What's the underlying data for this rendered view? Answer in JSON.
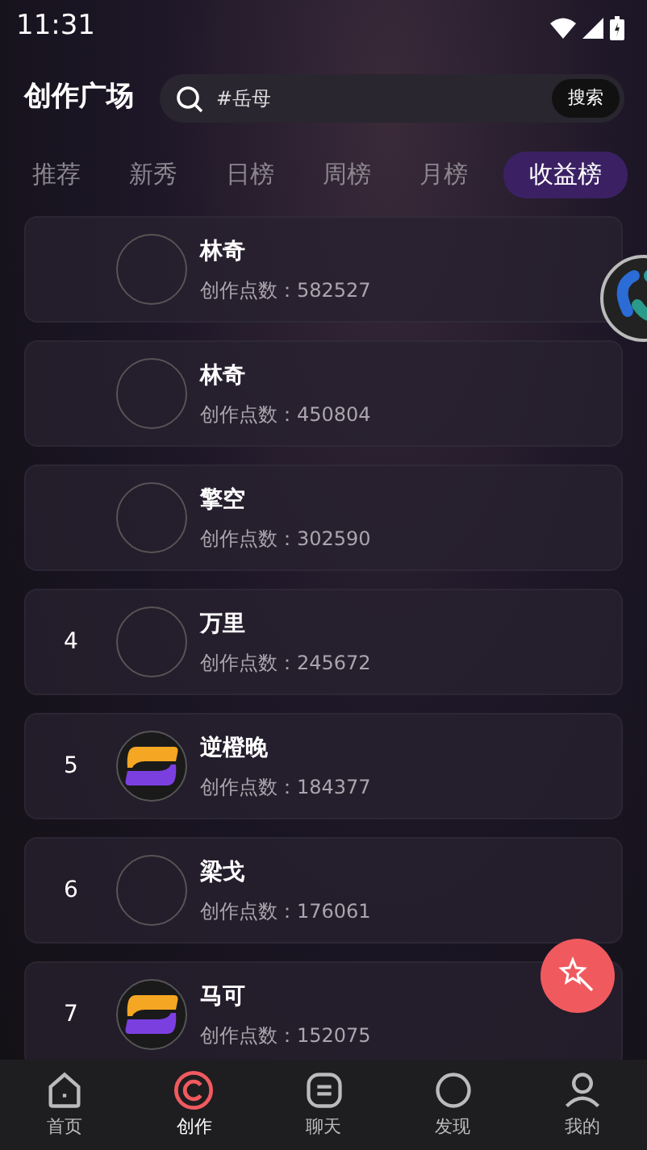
{
  "status_bar": {
    "time": "11:31"
  },
  "header": {
    "title": "创作广场",
    "search": {
      "value": "#岳母",
      "button": "搜索"
    }
  },
  "tabs": [
    {
      "label": "推荐",
      "selected": false
    },
    {
      "label": "新秀",
      "selected": false
    },
    {
      "label": "日榜",
      "selected": false
    },
    {
      "label": "周榜",
      "selected": false
    },
    {
      "label": "月榜",
      "selected": false
    },
    {
      "label": "收益榜",
      "selected": true
    }
  ],
  "ranking": [
    {
      "name": "林奇",
      "points": "创作点数：582527",
      "kind": "empty"
    },
    {
      "name": "林奇",
      "points": "创作点数：450804",
      "kind": "empty"
    },
    {
      "name": "擎空",
      "points": "创作点数：302590",
      "kind": "empty"
    },
    {
      "rank": "4",
      "name": "万里",
      "points": "创作点数：245672",
      "kind": "empty"
    },
    {
      "rank": "5",
      "name": "逆橙晚",
      "points": "创作点数：184377",
      "kind": "logo"
    },
    {
      "rank": "6",
      "name": "梁戈",
      "points": "创作点数：176061",
      "kind": "empty"
    },
    {
      "rank": "7",
      "name": "马可",
      "points": "创作点数：152075",
      "kind": "logo"
    }
  ],
  "bottom_nav": [
    {
      "label": "首页",
      "selected": false
    },
    {
      "label": "创作",
      "selected": true
    },
    {
      "label": "聊天",
      "selected": false
    },
    {
      "label": "发现",
      "selected": false
    },
    {
      "label": "我的",
      "selected": false
    }
  ]
}
